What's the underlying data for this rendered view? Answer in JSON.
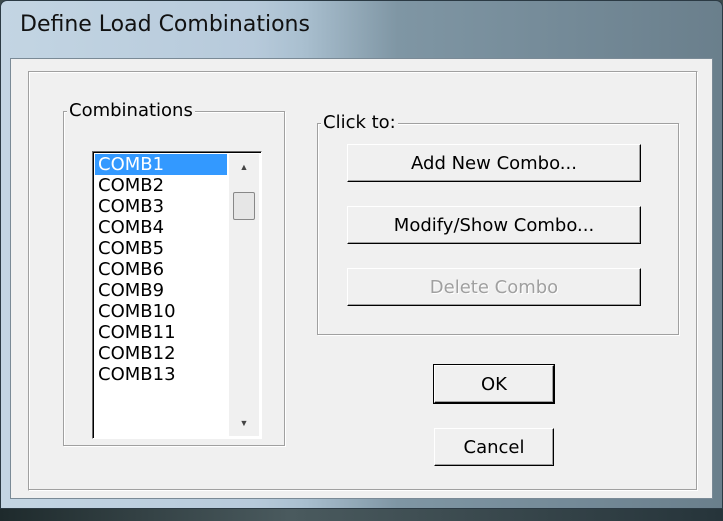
{
  "window": {
    "title": "Define Load Combinations"
  },
  "combinations_group": {
    "label": "Combinations",
    "items": [
      "COMB1",
      "COMB2",
      "COMB3",
      "COMB4",
      "COMB5",
      "COMB6",
      "COMB9",
      "COMB10",
      "COMB11",
      "COMB12",
      "COMB13"
    ],
    "selected": "COMB1"
  },
  "click_group": {
    "label": "Click to:",
    "add_label": "Add New Combo...",
    "modify_label": "Modify/Show Combo...",
    "delete_label": "Delete Combo"
  },
  "buttons": {
    "ok_label": "OK",
    "cancel_label": "Cancel"
  },
  "colors": {
    "selection": "#3399ff",
    "dialog_bg": "#f0f0f0"
  }
}
